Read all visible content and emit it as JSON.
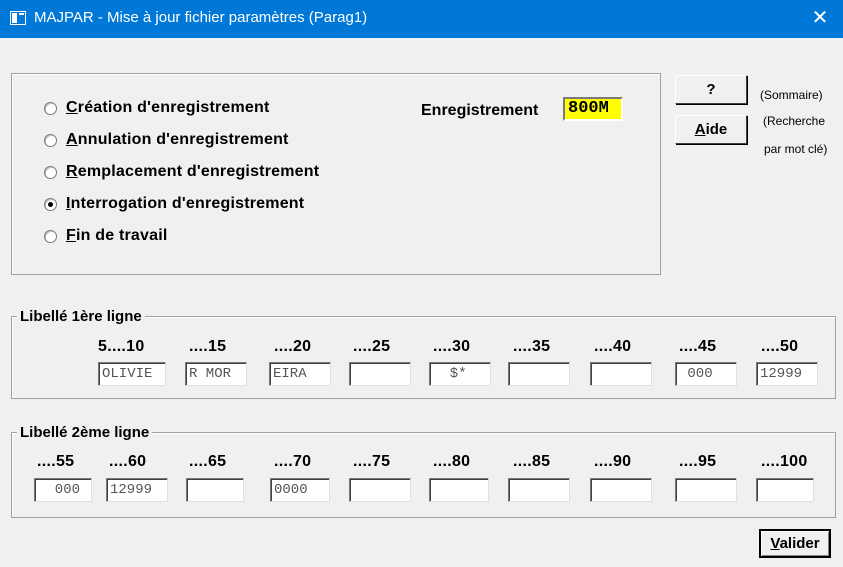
{
  "window": {
    "title": "MAJPAR - Mise à jour fichier paramètres (Parag1)",
    "close_glyph": "✕"
  },
  "actions": [
    {
      "ul": "C",
      "rest": "réation d'enregistrement",
      "checked": false
    },
    {
      "ul": "A",
      "rest": "nnulation d'enregistrement",
      "checked": false
    },
    {
      "ul": "R",
      "rest": "emplacement d'enregistrement",
      "checked": false
    },
    {
      "ul": "I",
      "rest": "nterrogation d'enregistrement",
      "checked": true
    },
    {
      "ul": "F",
      "rest": "in de travail",
      "checked": false
    }
  ],
  "enregistrement": {
    "label": "Enregistrement",
    "value": "800M",
    "highlight_color": "#ffff00"
  },
  "buttons": {
    "help": "?",
    "aide_ul": "A",
    "aide_rest": "ide",
    "valider_ul": "V",
    "valider_rest": "alider"
  },
  "hints": {
    "sommaire": "(Sommaire)",
    "recherche_1": "(Recherche",
    "recherche_2": "par mot clé)"
  },
  "ligne1": {
    "legend": "Libellé 1ère ligne",
    "positions": [
      "5....10",
      "....15",
      "....20",
      "....25",
      "....30",
      "....35",
      "....40",
      "....45",
      "....50"
    ],
    "values": [
      "OLIVIE",
      "R MOR",
      "EIRA",
      "",
      "  $*",
      "",
      "",
      " 000",
      "12999"
    ]
  },
  "ligne2": {
    "legend": "Libellé 2ème ligne",
    "positions": [
      "....55",
      "....60",
      "....65",
      "....70",
      "....75",
      "....80",
      "....85",
      "....90",
      "....95",
      "....100"
    ],
    "values": [
      "  000",
      "12999",
      "",
      "0000",
      "",
      "",
      "",
      "",
      "",
      ""
    ]
  }
}
